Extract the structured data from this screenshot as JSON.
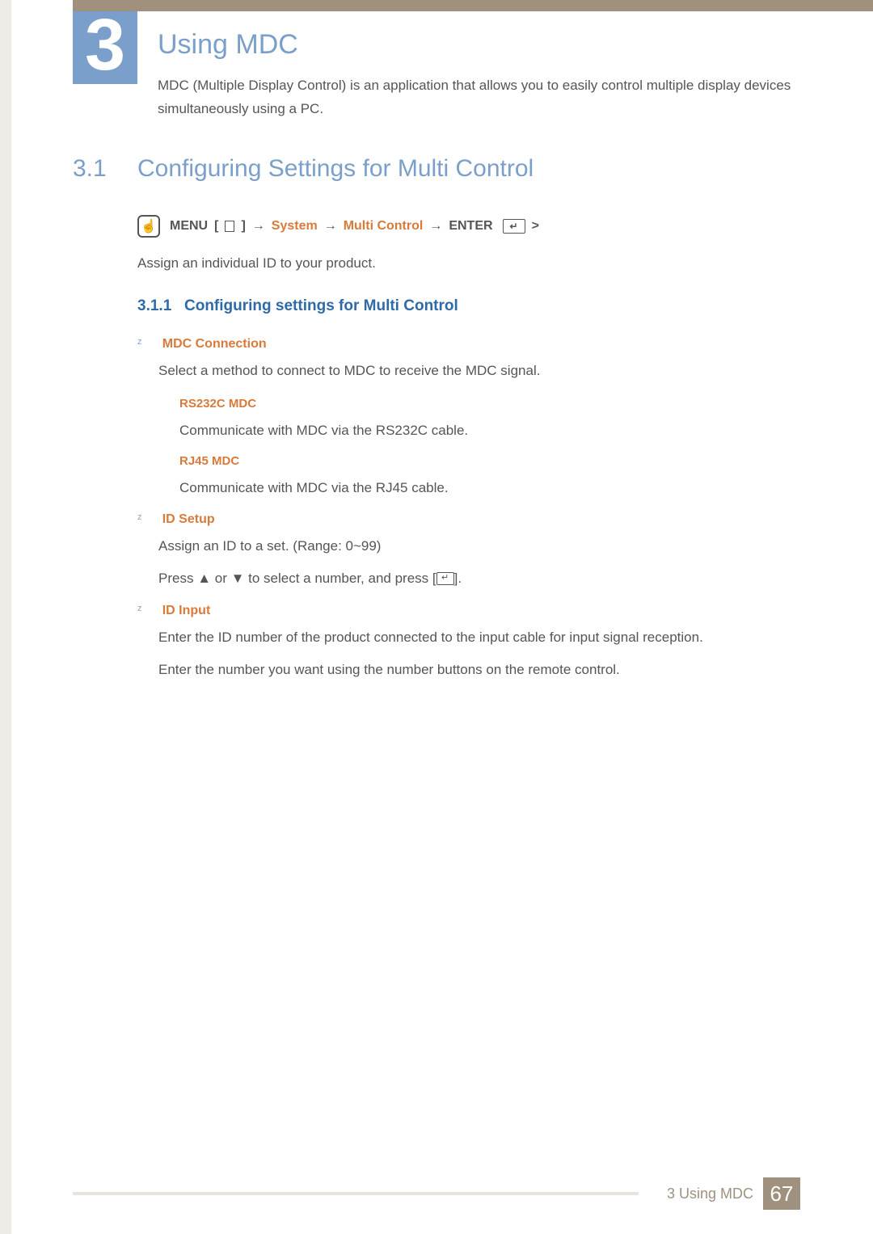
{
  "chapter": {
    "number": "3",
    "title": "Using MDC",
    "intro": "MDC (Multiple Display Control) is an application that allows you to easily control multiple display devices simultaneously using a PC."
  },
  "section": {
    "number": "3.1",
    "title": "Configuring Settings for Multi Control"
  },
  "nav": {
    "menu": "MENU",
    "bracket_open": "[",
    "bracket_close": "]",
    "arrow": "→",
    "system": "System",
    "multi_control": "Multi Control",
    "enter": "ENTER",
    "gt": ">"
  },
  "assign_line": "Assign an individual ID to your product.",
  "subsection": {
    "number": "3.1.1",
    "title": "Configuring settings for Multi Control"
  },
  "items": {
    "mdc_connection": {
      "title": "MDC Connection",
      "desc": "Select a method to connect to MDC to receive the MDC signal.",
      "rs232c": {
        "title": "RS232C MDC",
        "desc": "Communicate with MDC via the RS232C cable."
      },
      "rj45": {
        "title": "RJ45 MDC",
        "desc": "Communicate with MDC via the RJ45 cable."
      }
    },
    "id_setup": {
      "title": "ID Setup",
      "line1": "Assign an ID to a set. (Range: 0~99)",
      "line2a": "Press ",
      "up": "▲",
      "or": " or ",
      "down": "▼",
      "line2b": " to select a number, and press [",
      "line2c": "]."
    },
    "id_input": {
      "title": "ID Input",
      "line1": "Enter the ID number of the product connected to the input cable for input signal reception.",
      "line2": "Enter the number you want using the number buttons on the remote control."
    }
  },
  "footer": {
    "text": "3 Using MDC",
    "page": "67"
  }
}
